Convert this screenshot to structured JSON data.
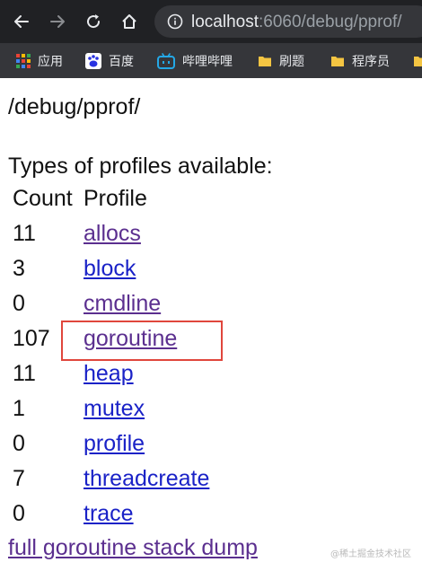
{
  "browser": {
    "url_host": "localhost",
    "url_rest": ":6060/debug/pprof/",
    "bookmarks": [
      {
        "label": "应用",
        "icon": "apps-grid-icon"
      },
      {
        "label": "百度",
        "icon": "baidu-icon"
      },
      {
        "label": "哔哩哔哩",
        "icon": "bilibili-icon"
      },
      {
        "label": "刷题",
        "icon": "folder-icon"
      },
      {
        "label": "程序员",
        "icon": "folder-icon"
      }
    ]
  },
  "page": {
    "path_heading": "/debug/pprof/",
    "types_heading": "Types of profiles available:",
    "columns": {
      "count": "Count",
      "profile": "Profile"
    },
    "profiles": [
      {
        "count": "11",
        "name": "allocs",
        "visited": true
      },
      {
        "count": "3",
        "name": "block",
        "visited": false
      },
      {
        "count": "0",
        "name": "cmdline",
        "visited": true
      },
      {
        "count": "107",
        "name": "goroutine",
        "visited": true
      },
      {
        "count": "11",
        "name": "heap",
        "visited": false
      },
      {
        "count": "1",
        "name": "mutex",
        "visited": false
      },
      {
        "count": "0",
        "name": "profile",
        "visited": false
      },
      {
        "count": "7",
        "name": "threadcreate",
        "visited": false
      },
      {
        "count": "0",
        "name": "trace",
        "visited": false
      }
    ],
    "full_dump_link": "full goroutine stack dump",
    "highlighted_profile": "goroutine",
    "watermark": "@稀土掘金技术社区"
  }
}
